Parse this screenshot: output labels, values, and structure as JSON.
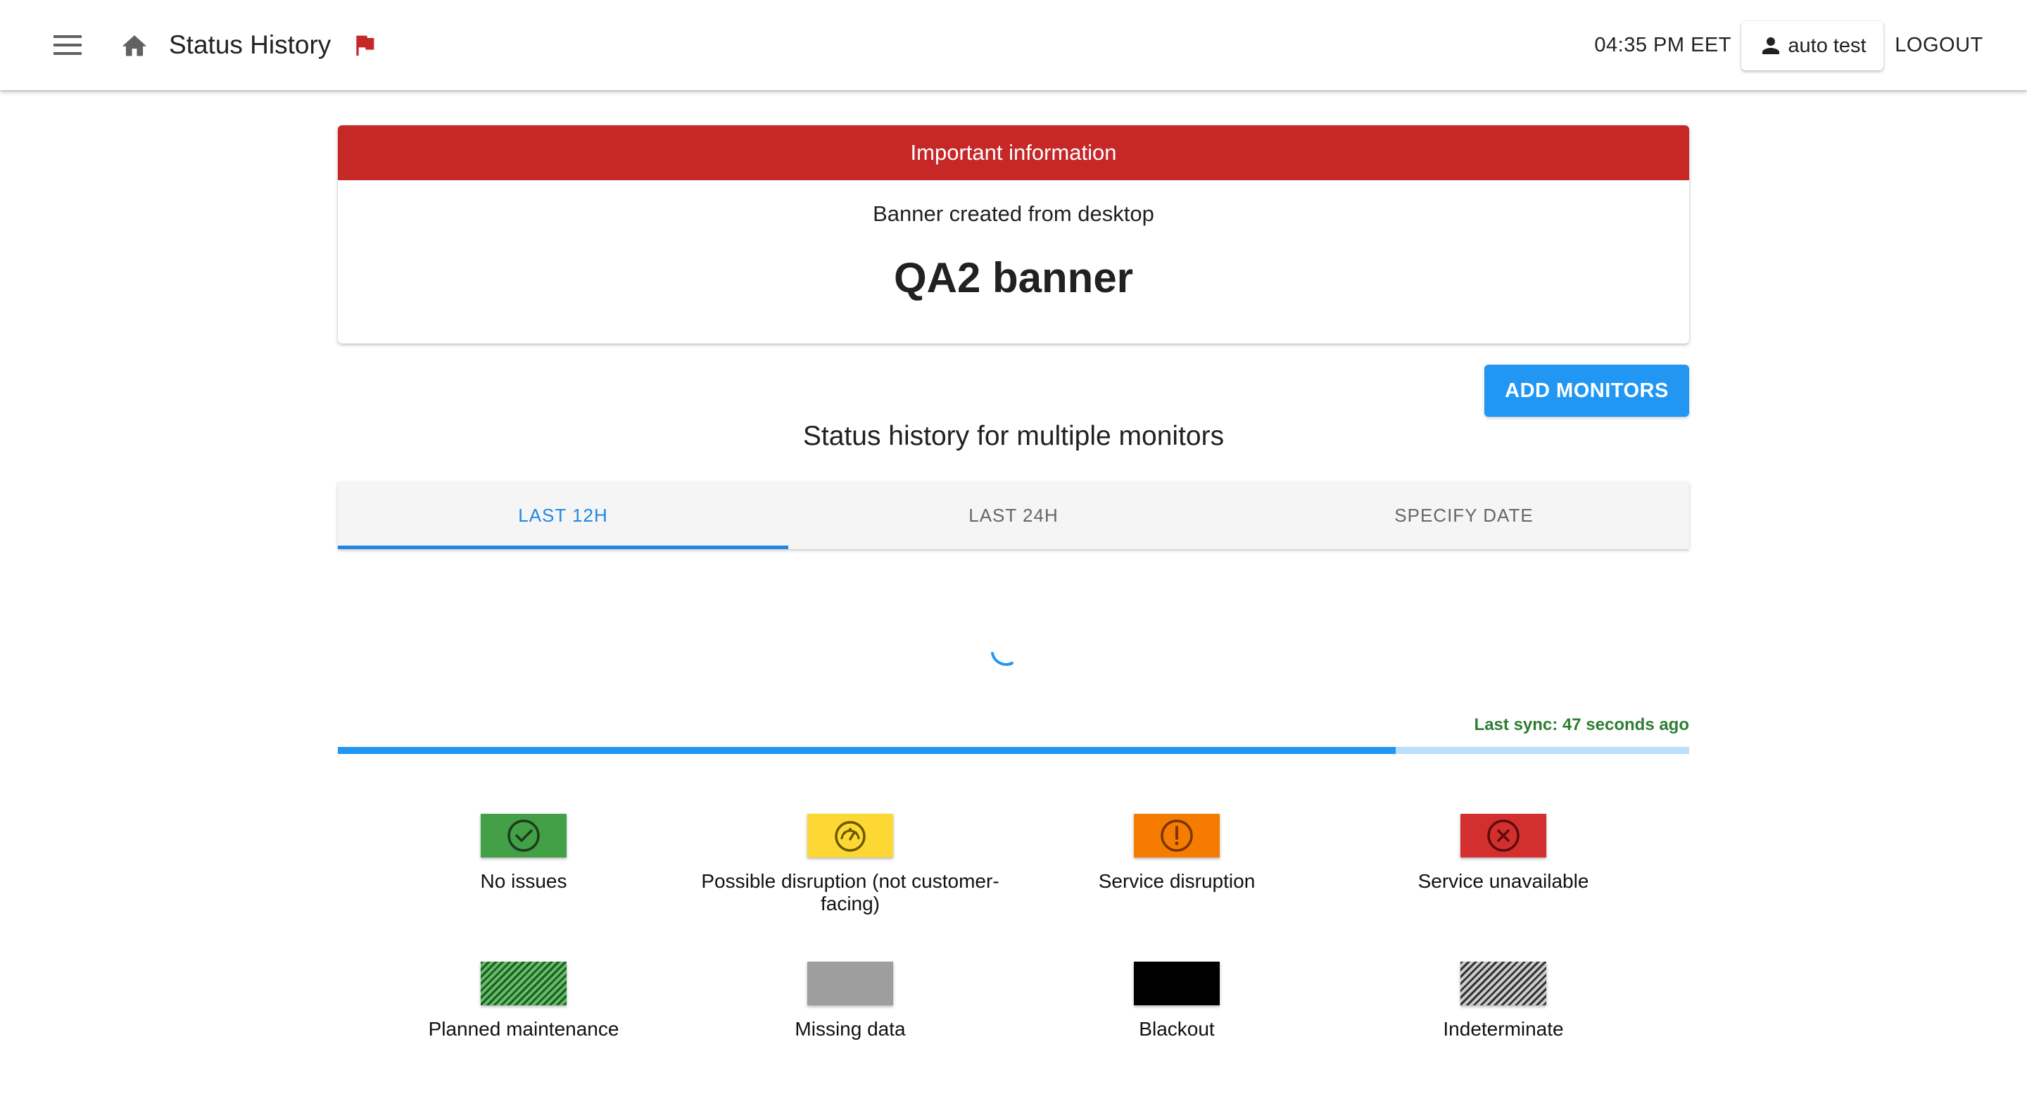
{
  "header": {
    "title": "Status History",
    "time": "04:35 PM EET",
    "user": "auto test",
    "logout": "LOGOUT"
  },
  "banner": {
    "header": "Important information",
    "subtitle": "Banner created from desktop",
    "title": "QA2 banner"
  },
  "actions": {
    "add_monitors": "ADD MONITORS"
  },
  "section_title": "Status history for multiple monitors",
  "tabs": [
    {
      "label": "LAST 12H",
      "active": true
    },
    {
      "label": "LAST 24H",
      "active": false
    },
    {
      "label": "SPECIFY DATE",
      "active": false
    }
  ],
  "sync": {
    "text": "Last sync: 47 seconds ago",
    "progress": 0.783
  },
  "legend": [
    {
      "label": "No issues",
      "icon": "check-circle-icon",
      "color": "#43a047"
    },
    {
      "label": "Possible disruption (not customer-facing)",
      "icon": "speedometer-icon",
      "color": "#fdd835"
    },
    {
      "label": "Service disruption",
      "icon": "exclamation-circle-icon",
      "color": "#f57c00"
    },
    {
      "label": "Service unavailable",
      "icon": "x-circle-icon",
      "color": "#d32f2f"
    },
    {
      "label": "Planned maintenance",
      "icon": "",
      "color": "#43a047"
    },
    {
      "label": "Missing data",
      "icon": "",
      "color": "#9e9e9e"
    },
    {
      "label": "Blackout",
      "icon": "",
      "color": "#000000"
    },
    {
      "label": "Indeterminate",
      "icon": "",
      "color": "#333333"
    }
  ],
  "colors": {
    "accent": "#2196f3",
    "banner_red": "#c62828",
    "sync_green": "#2e7d32",
    "flag_red": "#c62828"
  }
}
